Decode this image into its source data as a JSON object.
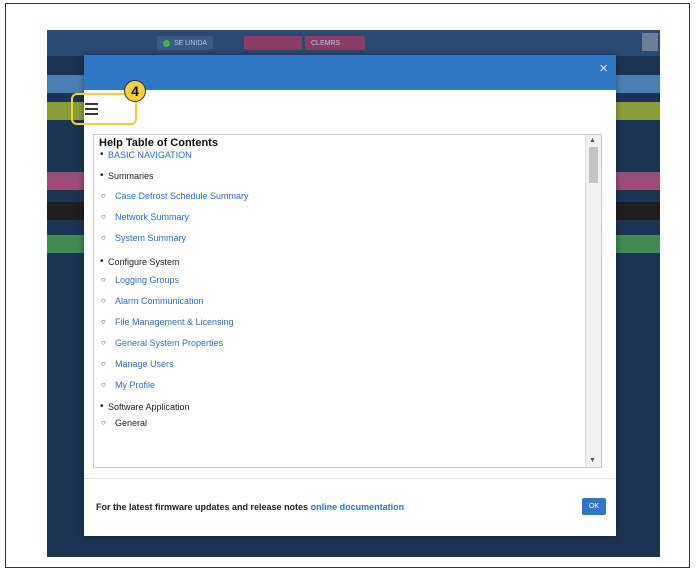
{
  "app": {
    "topbar_buttons": [
      {
        "label": "SE UNIDA",
        "color": "#3b5b86"
      },
      {
        "label": "",
        "color": "#8a3d66"
      },
      {
        "label": "CLEMRS",
        "color": "#8a3d66"
      }
    ],
    "stripes": [
      {
        "color": "#4a7fb4"
      },
      {
        "color": "#8a9c3a"
      },
      {
        "color": "#9a4d77"
      },
      {
        "color": "#1e1e1e"
      },
      {
        "color": "#3f8a55"
      }
    ]
  },
  "modal": {
    "close_label": "×",
    "callout_number": "4",
    "toc": {
      "title": "Help Table of Contents",
      "sections": [
        {
          "label": "BASIC NAVIGATION",
          "link": true,
          "items": []
        },
        {
          "label": "Summaries",
          "link": false,
          "items": [
            {
              "label": "Case Defrost Schedule Summary",
              "link": true
            },
            {
              "label": "Network Summary",
              "link": true
            },
            {
              "label": "System Summary",
              "link": true
            }
          ]
        },
        {
          "label": "Configure System",
          "link": false,
          "items": [
            {
              "label": "Logging Groups",
              "link": true
            },
            {
              "label": "Alarm Communication",
              "link": true
            },
            {
              "label": "File Management & Licensing",
              "link": true
            },
            {
              "label": "General System Properties",
              "link": true
            },
            {
              "label": "Manage Users",
              "link": true
            },
            {
              "label": "My Profile",
              "link": true
            }
          ]
        },
        {
          "label": "Software Application",
          "link": false,
          "items": [
            {
              "label": "General",
              "link": false
            }
          ]
        }
      ]
    },
    "footer_text": "For the latest firmware updates and release notes ",
    "footer_link": "online documentation",
    "ok_label": "OK"
  },
  "colors": {
    "accent": "#2f77c5",
    "callout": "#f2d13a",
    "link": "#2f6fc0"
  }
}
